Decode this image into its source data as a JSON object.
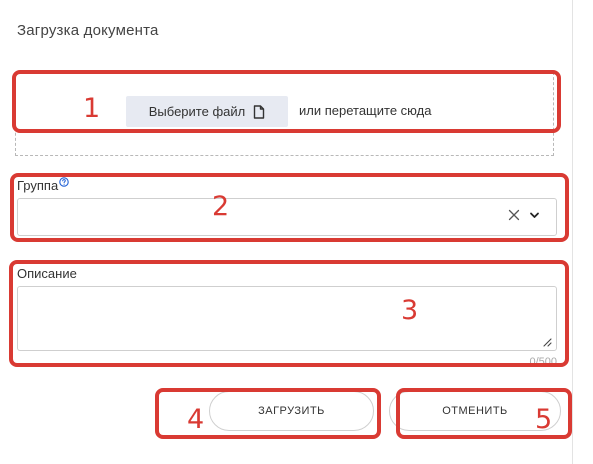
{
  "dialog": {
    "title": "Загрузка документа"
  },
  "upload": {
    "choose_label": "Выберите файл",
    "drop_hint": "или перетащите сюда"
  },
  "group": {
    "label": "Группа",
    "value": ""
  },
  "description": {
    "label": "Описание",
    "value": "",
    "counter": "0/500"
  },
  "actions": {
    "upload_label": "ЗАГРУЗИТЬ",
    "cancel_label": "ОТМЕНИТЬ"
  },
  "annotations": {
    "n1": "1",
    "n2": "2",
    "n3": "3",
    "n4": "4",
    "n5": "5"
  },
  "colors": {
    "annotation": "#d93a33",
    "button_bg": "#e7eaf2",
    "help_icon": "#1f5fd6"
  },
  "icons": {
    "file": "file-icon",
    "help": "help-icon",
    "clear": "clear-icon",
    "chevron": "chevron-down-icon",
    "resize": "resize-handle-icon"
  }
}
